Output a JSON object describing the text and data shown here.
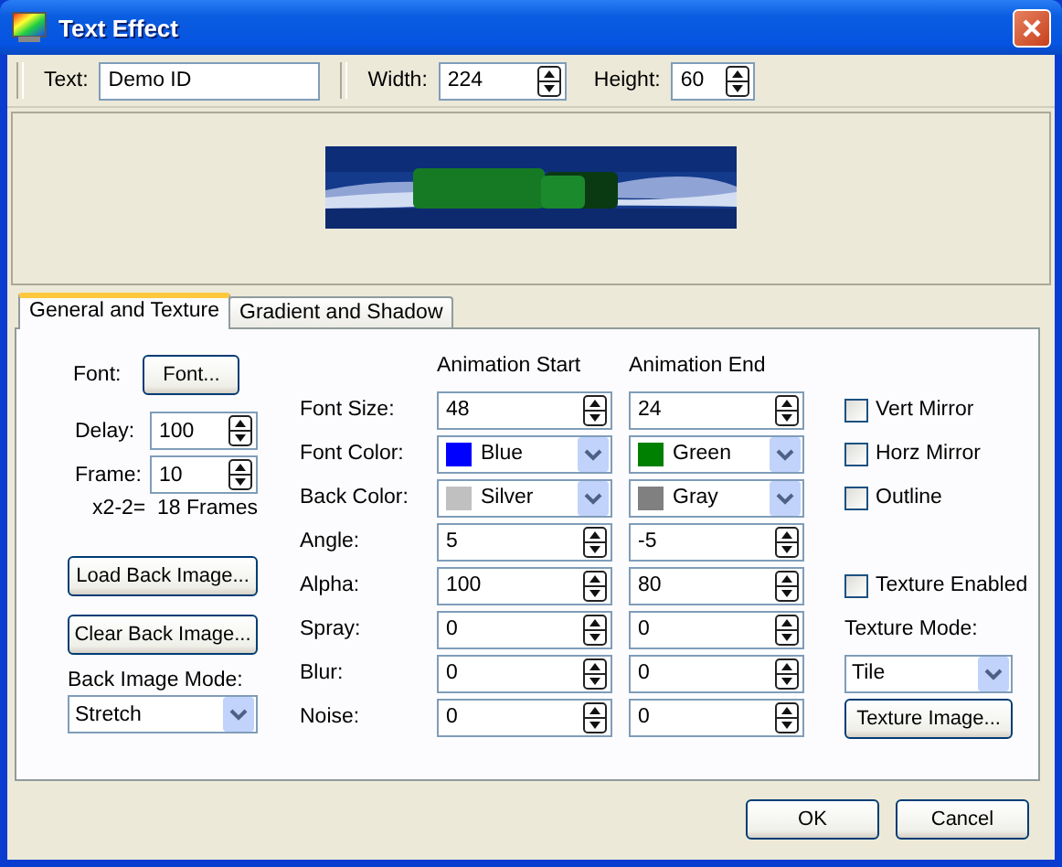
{
  "window": {
    "title": "Text Effect"
  },
  "toolbar": {
    "text": {
      "label": "Text:",
      "value": "Demo ID"
    },
    "width": {
      "label": "Width:",
      "value": "224"
    },
    "height": {
      "label": "Height:",
      "value": "60"
    }
  },
  "preview": {
    "kind": "picture"
  },
  "tabs": [
    {
      "label": "General and Texture",
      "selected": true
    },
    {
      "label": "Gradient and Shadow",
      "selected": false
    }
  ],
  "general": {
    "font": {
      "label": "Font:",
      "button": "Font..."
    },
    "delay": {
      "label": "Delay:",
      "value": "100"
    },
    "frame": {
      "label": "Frame:",
      "value": "10"
    },
    "frames_note": "x2-2=  18 Frames",
    "buttons": [
      "Load Back Image...",
      "Clear Back Image..."
    ],
    "back_image_mode": {
      "label": "Back Image Mode:",
      "value": "Stretch"
    }
  },
  "animation": {
    "columns": [
      "Animation Start",
      "Animation End"
    ],
    "rows": [
      {
        "label": "Font Size:",
        "kind": "spin",
        "start": {
          "value": "48"
        },
        "end": {
          "value": "24"
        }
      },
      {
        "label": "Font Color:",
        "kind": "color",
        "start": {
          "value": "Blue",
          "color": "#0000ff"
        },
        "end": {
          "value": "Green",
          "color": "#008000"
        }
      },
      {
        "label": "Back Color:",
        "kind": "color",
        "start": {
          "value": "Silver",
          "color": "#c0c0c0"
        },
        "end": {
          "value": "Gray",
          "color": "#808080"
        }
      },
      {
        "label": "Angle:",
        "kind": "spin",
        "start": {
          "value": "5"
        },
        "end": {
          "value": "-5"
        }
      },
      {
        "label": "Alpha:",
        "kind": "spin",
        "start": {
          "value": "100"
        },
        "end": {
          "value": "80"
        }
      },
      {
        "label": "Spray:",
        "kind": "spin",
        "start": {
          "value": "0"
        },
        "end": {
          "value": "0"
        }
      },
      {
        "label": "Blur:",
        "kind": "spin",
        "start": {
          "value": "0"
        },
        "end": {
          "value": "0"
        }
      },
      {
        "label": "Noise:",
        "kind": "spin",
        "start": {
          "value": "0"
        },
        "end": {
          "value": "0"
        }
      }
    ]
  },
  "options": {
    "checkboxes": [
      {
        "label": "Vert Mirror",
        "checked": false
      },
      {
        "label": "Horz Mirror",
        "checked": false
      },
      {
        "label": "Outline",
        "checked": false
      }
    ],
    "texture_enabled": {
      "label": "Texture Enabled",
      "checked": false
    },
    "texture_mode": {
      "label": "Texture Mode:",
      "value": "Tile"
    },
    "texture_button": "Texture Image..."
  },
  "buttons": [
    "OK",
    "Cancel"
  ]
}
